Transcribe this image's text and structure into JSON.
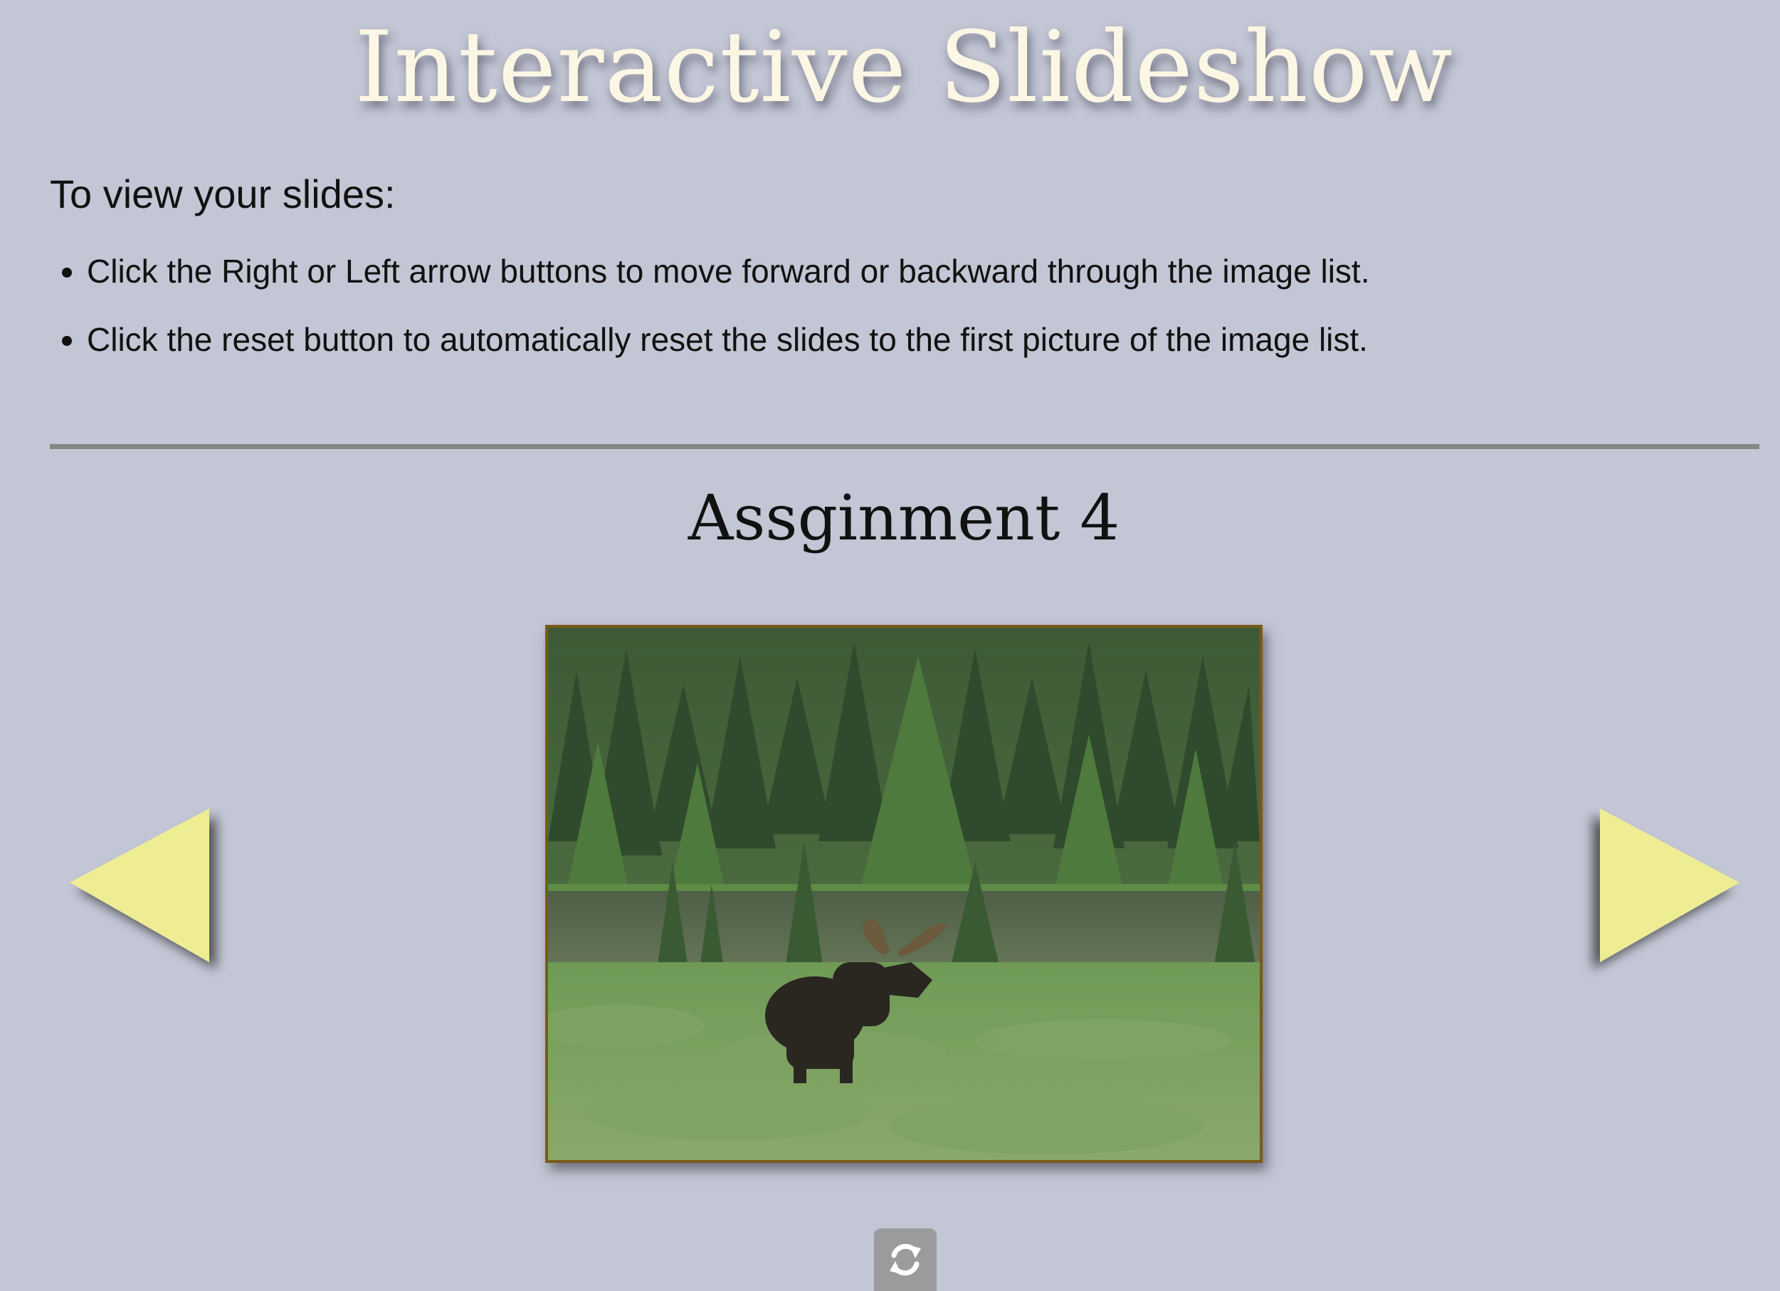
{
  "header": {
    "title": "Interactive Slideshow"
  },
  "instructions": {
    "heading": "To view your slides:",
    "items": [
      "Click the Right or Left arrow buttons to move forward or backward through the image list.",
      "Click the reset button to automatically reset the slides to the first picture of the image list."
    ]
  },
  "slideshow": {
    "title": "Assginment 4",
    "previous_icon": "left-triangle-arrow",
    "next_icon": "right-triangle-arrow",
    "reset_icon": "refresh-icon"
  },
  "colors": {
    "background": "#c3c6d4",
    "title_text": "#fbf7e4",
    "arrow_fill": "#eeed94",
    "frame_border": "#7a5a18",
    "divider": "#868686",
    "reset_button": "#9b9b9d"
  }
}
